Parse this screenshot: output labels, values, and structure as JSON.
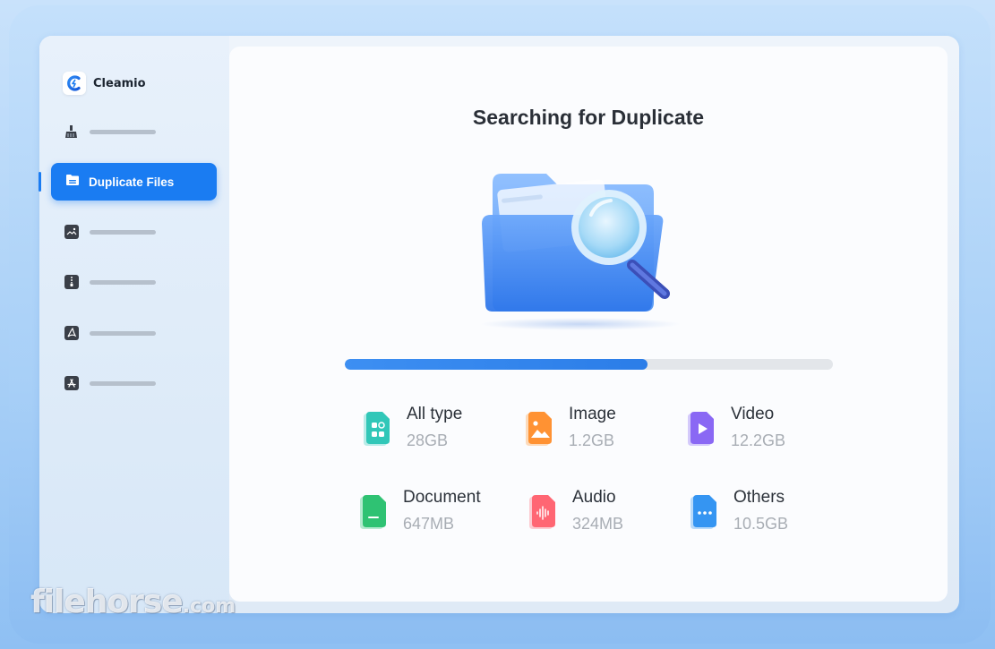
{
  "app": {
    "name": "Cleamio"
  },
  "sidebar": {
    "active_item": {
      "label": "Duplicate Files",
      "icon": "folder-icon"
    },
    "collapsed_items": [
      {
        "icon": "broom-icon"
      },
      {
        "icon": "image-icon"
      },
      {
        "icon": "zip-file-icon"
      },
      {
        "icon": "pdf-file-icon"
      },
      {
        "icon": "app-store-icon"
      }
    ]
  },
  "main": {
    "title": "Searching for Duplicate",
    "progress_fraction": 0.62,
    "categories": [
      {
        "name": "All type",
        "size": "28GB",
        "icon": "all-type-icon",
        "color": "#3ccfc0"
      },
      {
        "name": "Image",
        "size": "1.2GB",
        "icon": "image-file-icon",
        "color": "#ff9a3d"
      },
      {
        "name": "Video",
        "size": "12.2GB",
        "icon": "video-file-icon",
        "color": "#8b6cf5"
      },
      {
        "name": "Document",
        "size": "647MB",
        "icon": "document-file-icon",
        "color": "#34c97a"
      },
      {
        "name": "Audio",
        "size": "324MB",
        "icon": "audio-file-icon",
        "color": "#ff6f7d"
      },
      {
        "name": "Others",
        "size": "10.5GB",
        "icon": "others-file-icon",
        "color": "#3b9af3"
      }
    ]
  },
  "colors": {
    "accent": "#1a7cf2",
    "progress_track": "#e3e6ea"
  },
  "watermark": {
    "brand": "filehorse",
    "domain": ".com"
  }
}
